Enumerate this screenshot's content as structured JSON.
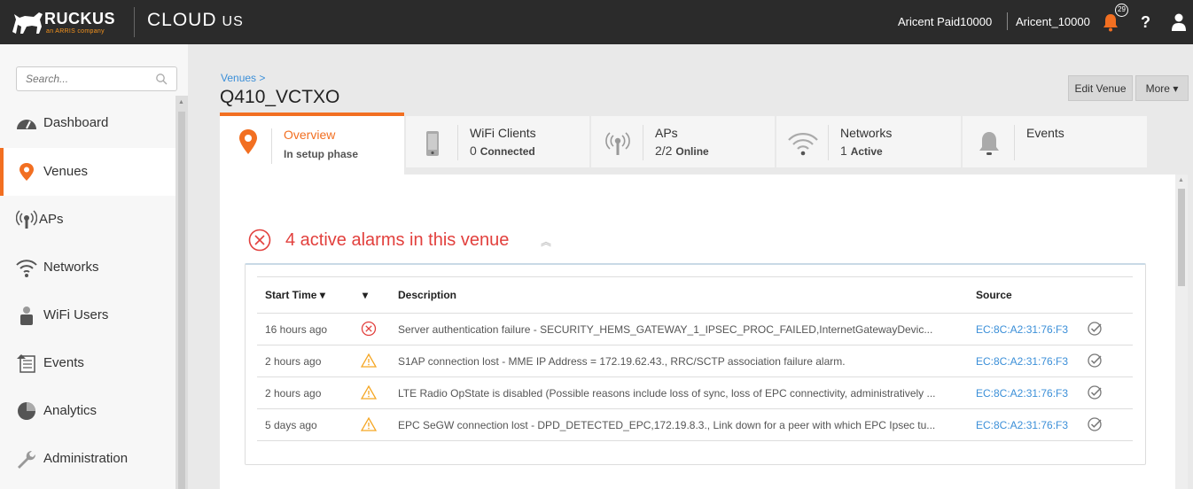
{
  "header": {
    "logo_text": "RUCKUS",
    "logo_subtext": "an ARRIS company",
    "product": "CLOUD",
    "region": "US",
    "account_name": "Aricent Paid10000",
    "account_id": "Aricent_10000",
    "notification_count": "29",
    "help_label": "?"
  },
  "sidebar": {
    "search_placeholder": "Search...",
    "items": [
      {
        "label": "Dashboard",
        "icon": "dashboard-icon"
      },
      {
        "label": "Venues",
        "icon": "location-pin-icon"
      },
      {
        "label": "APs",
        "icon": "access-point-icon"
      },
      {
        "label": "Networks",
        "icon": "wifi-icon"
      },
      {
        "label": "WiFi Users",
        "icon": "users-icon"
      },
      {
        "label": "Events",
        "icon": "events-icon"
      },
      {
        "label": "Analytics",
        "icon": "analytics-icon"
      },
      {
        "label": "Administration",
        "icon": "wrench-icon"
      }
    ]
  },
  "venue": {
    "breadcrumb": "Venues >",
    "title": "Q410_VCTXO",
    "edit_label": "Edit Venue",
    "more_label": "More"
  },
  "tabs": [
    {
      "title": "Overview",
      "sub": "In setup phase"
    },
    {
      "title": "WiFi Clients",
      "count": "0",
      "unit": "Connected"
    },
    {
      "title": "APs",
      "count": "2/2",
      "unit": "Online"
    },
    {
      "title": "Networks",
      "count": "1",
      "unit": "Active"
    },
    {
      "title": "Events"
    }
  ],
  "alarms": {
    "heading": "4 active alarms in this venue",
    "columns": {
      "start_time": "Start Time",
      "description": "Description",
      "source": "Source"
    },
    "rows": [
      {
        "time": "16 hours ago",
        "severity": "critical",
        "description": "Server authentication failure - SECURITY_HEMS_GATEWAY_1_IPSEC_PROC_FAILED,InternetGatewayDevic...",
        "source": "EC:8C:A2:31:76:F3"
      },
      {
        "time": "2 hours ago",
        "severity": "warning",
        "description": "S1AP connection lost - MME IP Address = 172.19.62.43., RRC/SCTP association failure alarm.",
        "source": "EC:8C:A2:31:76:F3"
      },
      {
        "time": "2 hours ago",
        "severity": "warning",
        "description": "LTE Radio OpState is disabled (Possible reasons include loss of sync, loss of EPC connectivity, administratively ...",
        "source": "EC:8C:A2:31:76:F3"
      },
      {
        "time": "5 days ago",
        "severity": "warning",
        "description": "EPC SeGW connection lost - DPD_DETECTED_EPC,172.19.8.3., Link down for a peer with which EPC Ipsec tu...",
        "source": "EC:8C:A2:31:76:F3"
      }
    ]
  },
  "colors": {
    "accent": "#f26f21",
    "link": "#3b8fd8",
    "alarm": "#e2403d",
    "warning": "#f5a623",
    "topbar": "#2b2b2b"
  }
}
